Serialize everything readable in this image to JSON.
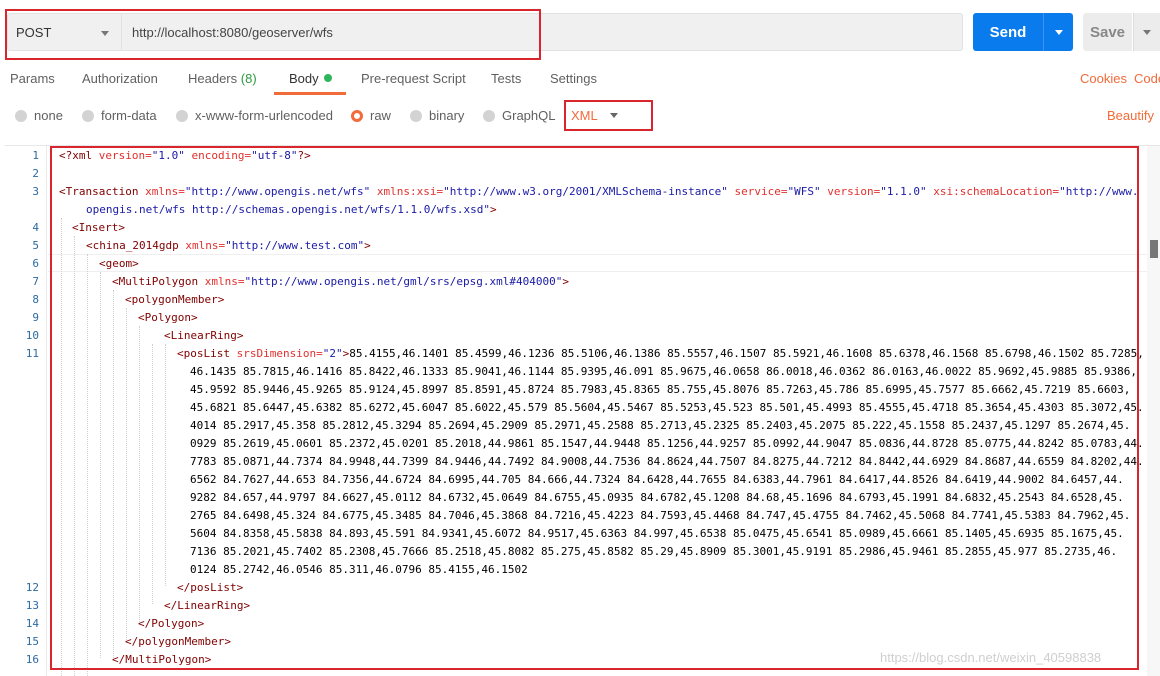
{
  "request": {
    "method": "POST",
    "url": "http://localhost:8080/geoserver/wfs",
    "send_label": "Send",
    "save_label": "Save"
  },
  "tabs": [
    {
      "label": "Params"
    },
    {
      "label": "Authorization"
    },
    {
      "label": "Headers",
      "count": "(8)"
    },
    {
      "label": "Body",
      "active": true
    },
    {
      "label": "Pre-request Script"
    },
    {
      "label": "Tests"
    },
    {
      "label": "Settings"
    }
  ],
  "links": {
    "cookies": "Cookies",
    "code": "Code",
    "beautify": "Beautify"
  },
  "body_types": [
    {
      "label": "none"
    },
    {
      "label": "form-data"
    },
    {
      "label": "x-www-form-urlencoded"
    },
    {
      "label": "raw",
      "selected": true
    },
    {
      "label": "binary"
    },
    {
      "label": "GraphQL"
    }
  ],
  "raw_language": "XML",
  "editor": {
    "line_numbers": [
      "1",
      "2",
      "3",
      "4",
      "5",
      "6",
      "7",
      "8",
      "9",
      "10",
      "11",
      "12",
      "13",
      "14",
      "15",
      "16"
    ],
    "decl": {
      "open": "<?xml ",
      "a1": "version=",
      "v1": "\"1.0\"",
      "a2": " encoding=",
      "v2": "\"utf-8\"",
      "close": "?>"
    },
    "transaction": {
      "tag": "<Transaction ",
      "a1": "xmlns=",
      "v1": "\"http://www.opengis.net/wfs\"",
      "a2": " xmlns:xsi=",
      "v2": "\"http://www.w3.org/2001/XMLSchema-instance\"",
      "a3": " service=",
      "v3": "\"WFS\"",
      "a4": " version=",
      "v4": "\"1.1.0\"",
      "a5": " xsi:schemaLocation=",
      "v5a": "\"http://www.",
      "v5b": "opengis.net/wfs http://schemas.opengis.net/wfs/1.1.0/wfs.xsd\"",
      "end": ">"
    },
    "insert": "<Insert>",
    "feature": {
      "tag": "<china_2014gdp ",
      "a1": "xmlns=",
      "v1": "\"http://www.test.com\"",
      "end": ">"
    },
    "geom": {
      "lt": "<",
      "name": "geom",
      "gt": ">"
    },
    "multipolygon": {
      "tag": "<MultiPolygon ",
      "a1": "xmlns=",
      "v1": "\"http://www.opengis.net/gml/srs/epsg.xml#404000\"",
      "end": ">"
    },
    "polygon_member": "<polygonMember>",
    "polygon": "<Polygon>",
    "linear_ring": "<LinearRing>",
    "poslist": {
      "tag": "<posList ",
      "a1": "srsDimension=",
      "v1": "\"2\"",
      "end": ">"
    },
    "coords": [
      "85.4155,46.1401 85.4599,46.1236 85.5106,46.1386 85.5557,46.1507 85.5921,46.1608 85.6378,46.1568 85.6798,46.1502 85.7285,",
      "46.1435 85.7815,46.1416 85.8422,46.1333 85.9041,46.1144 85.9395,46.091 85.9675,46.0658 86.0018,46.0362 86.0163,46.0022 85.9692,45.9885 85.9386,",
      "45.9592 85.9446,45.9265 85.9124,45.8997 85.8591,45.8724 85.7983,45.8365 85.755,45.8076 85.7263,45.786 85.6995,45.7577 85.6662,45.7219 85.6603,",
      "45.6821 85.6447,45.6382 85.6272,45.6047 85.6022,45.579 85.5604,45.5467 85.5253,45.523 85.501,45.4993 85.4555,45.4718 85.3654,45.4303 85.3072,45.",
      "4014 85.2917,45.358 85.2812,45.3294 85.2694,45.2909 85.2971,45.2588 85.2713,45.2325 85.2403,45.2075 85.222,45.1558 85.2437,45.1297 85.2674,45.",
      "0929 85.2619,45.0601 85.2372,45.0201 85.2018,44.9861 85.1547,44.9448 85.1256,44.9257 85.0992,44.9047 85.0836,44.8728 85.0775,44.8242 85.0783,44.",
      "7783 85.0871,44.7374 84.9948,44.7399 84.9446,44.7492 84.9008,44.7536 84.8624,44.7507 84.8275,44.7212 84.8442,44.6929 84.8687,44.6559 84.8202,44.",
      "6562 84.7627,44.653 84.7356,44.6724 84.6995,44.705 84.666,44.7324 84.6428,44.7655 84.6383,44.7961 84.6417,44.8526 84.6419,44.9002 84.6457,44.",
      "9282 84.657,44.9797 84.6627,45.0112 84.6732,45.0649 84.6755,45.0935 84.6782,45.1208 84.68,45.1696 84.6793,45.1991 84.6832,45.2543 84.6528,45.",
      "2765 84.6498,45.324 84.6775,45.3485 84.7046,45.3868 84.7216,45.4223 84.7593,45.4468 84.747,45.4755 84.7462,45.5068 84.7741,45.5383 84.7962,45.",
      "5604 84.8358,45.5838 84.893,45.591 84.9341,45.6072 84.9517,45.6363 84.997,45.6538 85.0475,45.6541 85.0989,45.6661 85.1405,45.6935 85.1675,45.",
      "7136 85.2021,45.7402 85.2308,45.7666 85.2518,45.8082 85.275,45.8582 85.29,45.8909 85.3001,45.9191 85.2986,45.9461 85.2855,45.977 85.2735,46.",
      "0124 85.2742,46.0546 85.311,46.0796 85.4155,46.1502"
    ],
    "poslist_close": "</posList>",
    "linear_ring_close": "</LinearRing>",
    "polygon_close": "</Polygon>",
    "polygon_member_close": "</polygonMember>",
    "multipolygon_close": "</MultiPolygon>"
  },
  "watermark": "https://blog.csdn.net/weixin_40598838",
  "colors": {
    "accent": "#f26b3a",
    "send": "#097bed",
    "highlight_box": "#d9262c"
  }
}
